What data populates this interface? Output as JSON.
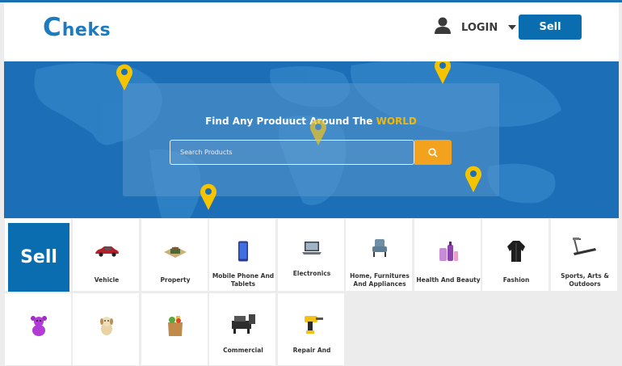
{
  "header": {
    "logo_mark": "C",
    "logo_text": "heks",
    "login_label": "LOGIN",
    "sell_label": "Sell"
  },
  "hero": {
    "title_main": "Find Any Produuct Around The ",
    "title_accent": "WORLD",
    "search_placeholder": "Search Products"
  },
  "categories": {
    "sell_tile_label": "Sell",
    "items": [
      {
        "label": "Vehicle",
        "icon": "car-icon"
      },
      {
        "label": "Property",
        "icon": "property-icon"
      },
      {
        "label": "Mobile Phone And Tablets",
        "icon": "phone-icon"
      },
      {
        "label": "Electronics",
        "icon": "laptop-icon"
      },
      {
        "label": "Home, Furnitures And Appliances",
        "icon": "armchair-icon"
      },
      {
        "label": "Health And Beauty",
        "icon": "cosmetics-icon"
      },
      {
        "label": "Fashion",
        "icon": "jacket-icon"
      },
      {
        "label": "Sports, Arts & Outdoors",
        "icon": "treadmill-icon"
      },
      {
        "label": "",
        "icon": "teddy-bear-icon"
      },
      {
        "label": "",
        "icon": "dog-icon"
      },
      {
        "label": "",
        "icon": "grocery-bag-icon"
      },
      {
        "label": "Commercial",
        "icon": "machine-icon"
      },
      {
        "label": "Repair And",
        "icon": "drill-icon"
      }
    ]
  },
  "colors": {
    "brand": "#1e7bbf",
    "primary_button": "#0a6db0",
    "accent": "#f5b800",
    "search_button": "#f2a21c"
  }
}
